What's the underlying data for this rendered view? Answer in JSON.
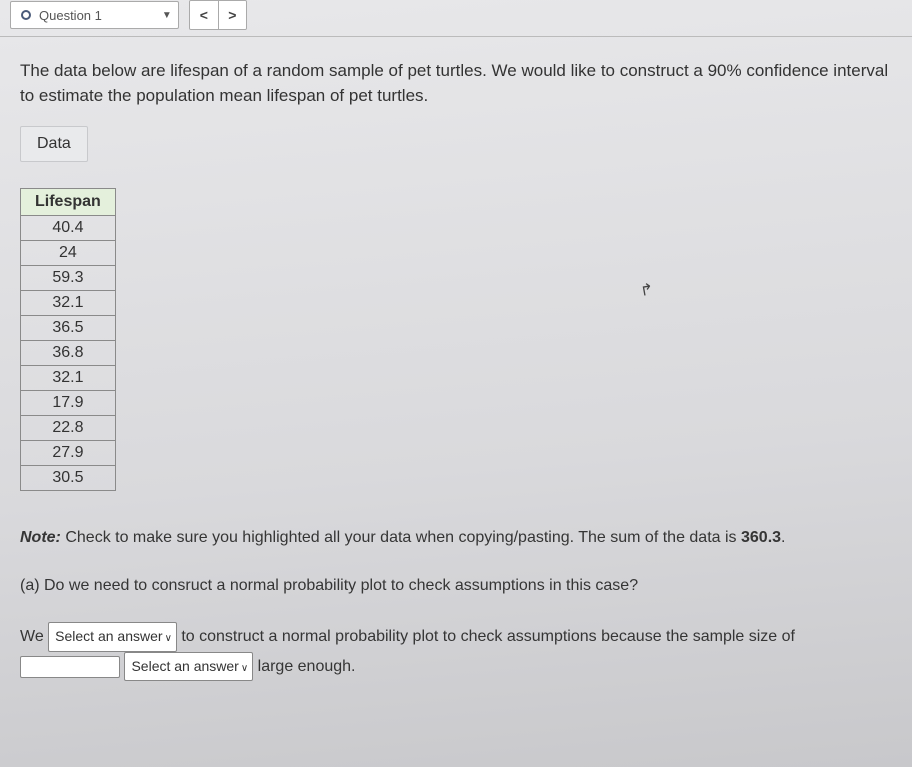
{
  "topbar": {
    "question_label": "Question 1",
    "prev_glyph": "<",
    "next_glyph": ">"
  },
  "prompt": "The data below are lifespan of a random sample of pet turtles. We would like to construct a 90% confidence interval to estimate the population mean lifespan of pet turtles.",
  "data_button": "Data",
  "table": {
    "header": "Lifespan",
    "values": [
      "40.4",
      "24",
      "59.3",
      "32.1",
      "36.5",
      "36.8",
      "32.1",
      "17.9",
      "22.8",
      "27.9",
      "30.5"
    ]
  },
  "note": {
    "label": "Note:",
    "text": " Check to make sure you highlighted all your data when copying/pasting. The sum of the data is ",
    "sum": "360.3",
    "period": "."
  },
  "part_a": {
    "label": "(a) Do we need to consruct a normal probability plot to check assumptions in this case?",
    "line_prefix": "We ",
    "select1": "Select an answer",
    "mid1": " to construct a normal probability plot to check assumptions because the sample size of ",
    "select2": "Select an answer",
    "tail": " large enough."
  }
}
